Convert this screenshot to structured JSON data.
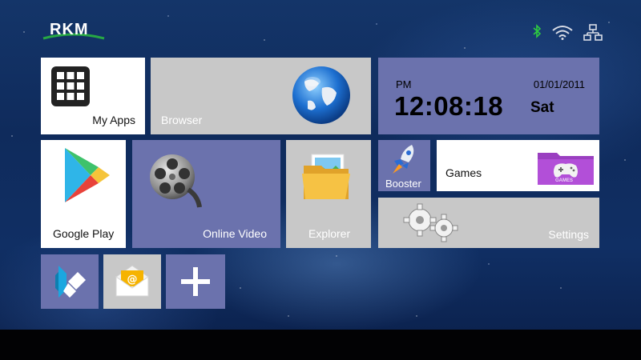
{
  "brand": {
    "logo_text": "RKM"
  },
  "status_bar": {
    "icons": [
      "bluetooth-icon",
      "wifi-icon",
      "ethernet-icon"
    ],
    "bluetooth_color": "#2ecc40"
  },
  "tiles": {
    "my_apps": {
      "label": "My Apps"
    },
    "browser": {
      "label": "Browser"
    },
    "clock": {
      "ampm": "PM",
      "date": "01/01/2011",
      "time": "12:08:18",
      "day": "Sat"
    },
    "google_play": {
      "label": "Google Play"
    },
    "online_video": {
      "label": "Online Video"
    },
    "explorer": {
      "label": "Explorer"
    },
    "booster": {
      "label": "Booster"
    },
    "games": {
      "label": "Games",
      "badge": "GAMES"
    },
    "settings": {
      "label": "Settings"
    },
    "shortcuts": [
      "kodi-icon",
      "email-icon",
      "add-icon"
    ]
  },
  "colors": {
    "tile_blue": "#6b72ad",
    "tile_grey": "#c8c8c8",
    "tile_white": "#ffffff"
  }
}
